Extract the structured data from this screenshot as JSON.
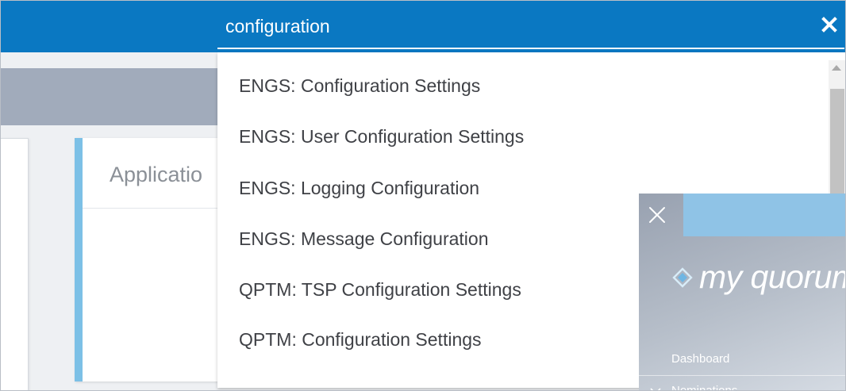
{
  "search": {
    "query": "configuration"
  },
  "background": {
    "card_title": "Applicatio"
  },
  "suggestions": [
    {
      "label": "ENGS: Configuration Settings"
    },
    {
      "label": "ENGS: User Configuration Settings"
    },
    {
      "label": "ENGS: Logging Configuration"
    },
    {
      "label": "ENGS: Message Configuration"
    },
    {
      "label": "QPTM: TSP Configuration Settings"
    },
    {
      "label": "QPTM: Configuration Settings"
    }
  ],
  "side_menu": {
    "logo_text": "my quorum",
    "items": [
      {
        "label": "Dashboard"
      },
      {
        "label": "Nominations"
      }
    ]
  },
  "icons": {
    "search_close": "close-icon",
    "menu_close": "close-icon",
    "logo": "diamond-logo-icon",
    "nominations_chevron": "chevron-down-icon"
  },
  "colors": {
    "header_blue": "#0a78c2",
    "accent_light_blue": "#7cc0e6",
    "toolbar_grey": "#a1abbb",
    "text_dark": "#3f4146"
  }
}
